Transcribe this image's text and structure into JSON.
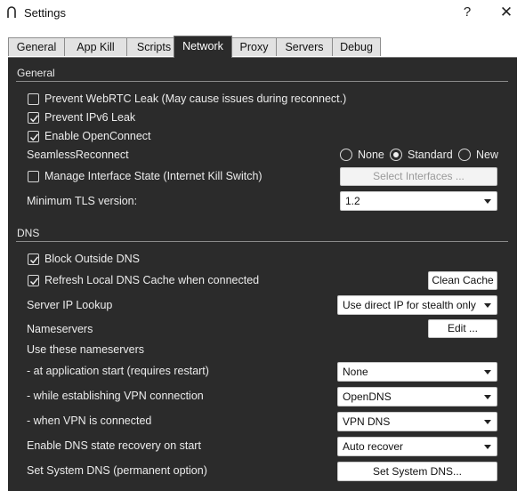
{
  "window": {
    "title": "Settings",
    "help_glyph": "?",
    "close_glyph": "✕"
  },
  "tabs": [
    {
      "label": "General"
    },
    {
      "label": "App Kill"
    },
    {
      "label": "Scripts"
    },
    {
      "label": "Network",
      "active": true
    },
    {
      "label": "Proxy"
    },
    {
      "label": "Servers"
    },
    {
      "label": "Debug"
    }
  ],
  "general": {
    "section_title": "General",
    "prevent_webrtc": {
      "label": "Prevent WebRTC Leak (May cause issues during reconnect.)",
      "checked": false
    },
    "prevent_ipv6": {
      "label": "Prevent IPv6 Leak",
      "checked": true
    },
    "enable_openconnect": {
      "label": "Enable OpenConnect",
      "checked": true
    },
    "seamless_reconnect": {
      "label": "SeamlessReconnect",
      "options": [
        "None",
        "Standard",
        "New"
      ],
      "selected": "Standard"
    },
    "manage_interface": {
      "label": "Manage Interface State (Internet Kill Switch)",
      "checked": false,
      "button": "Select Interfaces ..."
    },
    "min_tls": {
      "label": "Minimum TLS version:",
      "value": "1.2"
    }
  },
  "dns": {
    "section_title": "DNS",
    "block_outside": {
      "label": "Block Outside DNS",
      "checked": true
    },
    "refresh_cache": {
      "label": "Refresh Local DNS Cache when connected",
      "checked": true,
      "button": "Clean Cache"
    },
    "server_ip_lookup": {
      "label": "Server IP Lookup",
      "value": "Use direct IP for stealth only"
    },
    "nameservers": {
      "label": "Nameservers",
      "button": "Edit ..."
    },
    "use_these": {
      "label": "Use these nameservers"
    },
    "at_app_start": {
      "label": " - at application start (requires restart)",
      "value": "None"
    },
    "while_establishing": {
      "label": " - while establishing VPN connection",
      "value": "OpenDNS"
    },
    "when_connected": {
      "label": " - when VPN is connected",
      "value": "VPN DNS"
    },
    "state_recovery": {
      "label": "Enable DNS state recovery on start",
      "value": "Auto recover"
    },
    "set_system_dns": {
      "label": "Set System DNS (permanent option)",
      "button": "Set System DNS..."
    }
  },
  "colors": {
    "panel_bg": "#2b2b2b",
    "text_light": "#ececec",
    "control_bg": "#ffffff"
  }
}
